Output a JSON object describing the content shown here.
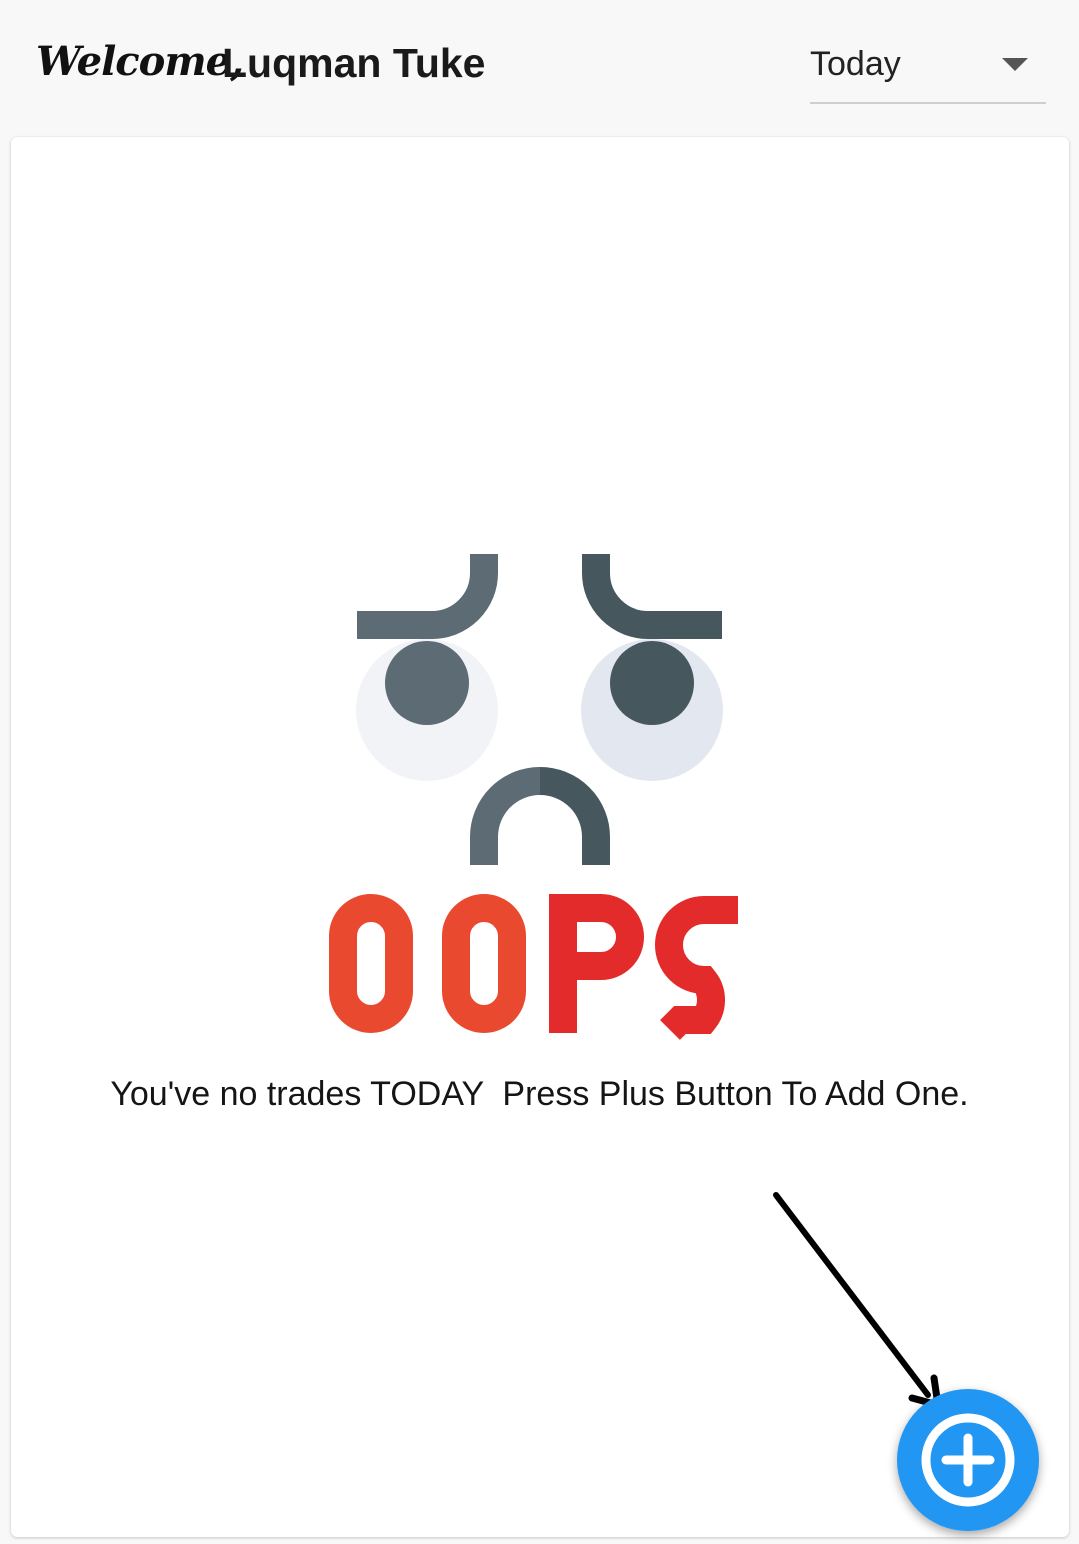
{
  "header": {
    "welcome_label": "Welcome,",
    "user_name": "Luqman Tuke",
    "period_select": {
      "selected": "Today"
    }
  },
  "empty_state": {
    "headline": "OOPS",
    "message": "You've no trades TODAY  Press Plus Button To Add One."
  },
  "fab": {
    "icon": "plus-circle-icon",
    "color": "#2196f3"
  },
  "colors": {
    "oops_orange": "#e9492f",
    "oops_red": "#e32b2b",
    "face_dark": "#5c6b74",
    "face_darker": "#46575e",
    "eye_white_left": "#f1f3f7",
    "eye_white_right": "#e2e7f0"
  }
}
